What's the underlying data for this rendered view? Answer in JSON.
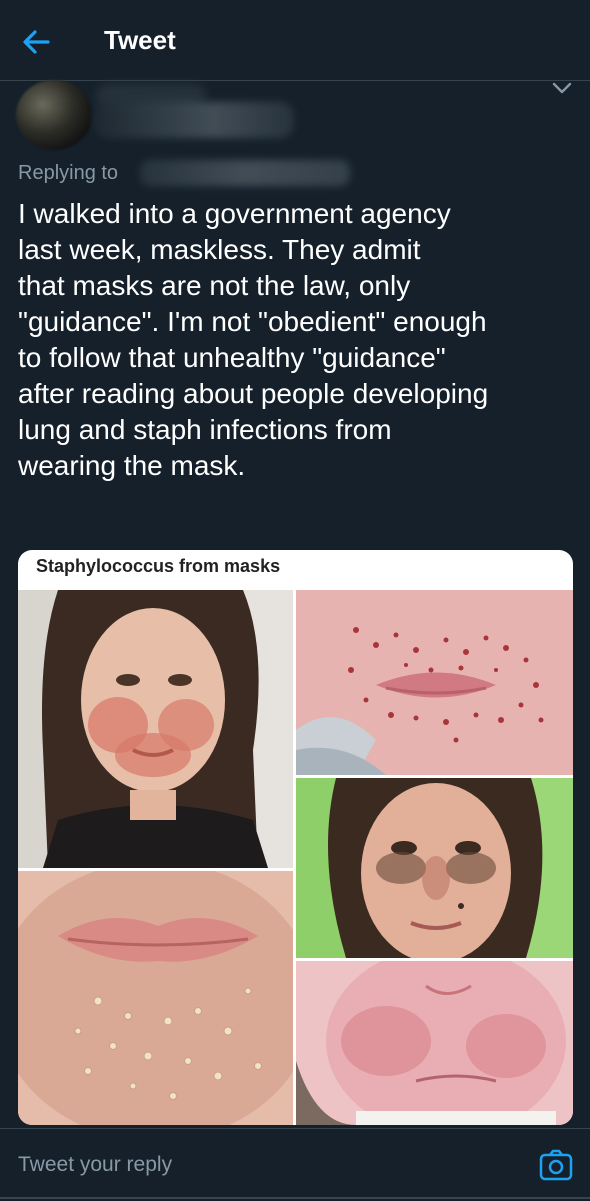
{
  "header": {
    "title": "Tweet"
  },
  "reply_context": {
    "label": "Replying to"
  },
  "tweet": {
    "text": "I walked into a government agency\nlast week, maskless. They admit\nthat masks are not the law, only\n\"guidance\". I'm not \"obedient\" enough\nto follow that unhealthy \"guidance\"\nafter reading about people developing\nlung and staph infections from\nwearing the mask."
  },
  "media": {
    "caption": "Staphylococcus from masks"
  },
  "reply_bar": {
    "placeholder": "Tweet your reply"
  },
  "colors": {
    "background": "#15202b",
    "accent": "#1da1f2",
    "secondary_text": "#8899a6",
    "divider": "#38444d"
  },
  "icons": {
    "back": "arrow-left-icon",
    "more": "chevron-down-icon",
    "camera": "camera-icon"
  }
}
